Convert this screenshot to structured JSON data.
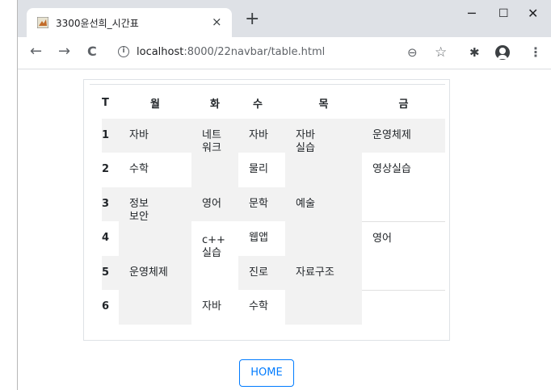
{
  "browser": {
    "tab_title": "3300윤선희_시간표",
    "tab_close": "×",
    "new_tab": "+",
    "minimize": "─",
    "maximize": "☐",
    "close": "✕",
    "url_host": "localhost",
    "url_path": ":8000/22navbar/table.html",
    "back": "←",
    "forward": "→",
    "reload": "C",
    "zoom_icon": "⊖",
    "star_icon": "☆",
    "extensions_icon": "✱",
    "menu_icon": "⋮"
  },
  "timetable": {
    "headers": [
      "T",
      "월",
      "화",
      "수",
      "목",
      "금"
    ],
    "rows": [
      {
        "period": "1",
        "mon": "자바",
        "tue": "네트\n워크",
        "wed": "자바",
        "thu": "자바\n실습",
        "fri": "운영체제"
      },
      {
        "period": "2",
        "mon": "수학",
        "wed": "물리",
        "fri": "영상실습"
      },
      {
        "period": "3",
        "mon": "정보\n보안",
        "tue": "영어",
        "wed": "문학",
        "thu": "예술"
      },
      {
        "period": "4",
        "tue": "c++\n실습",
        "wed": "웹앱",
        "fri": "영어"
      },
      {
        "period": "5",
        "mon": "운영체제",
        "wed": "진로",
        "thu": "자료구조"
      },
      {
        "period": "6",
        "tue": "자바",
        "wed": "수학"
      }
    ]
  },
  "home_button": "HOME"
}
